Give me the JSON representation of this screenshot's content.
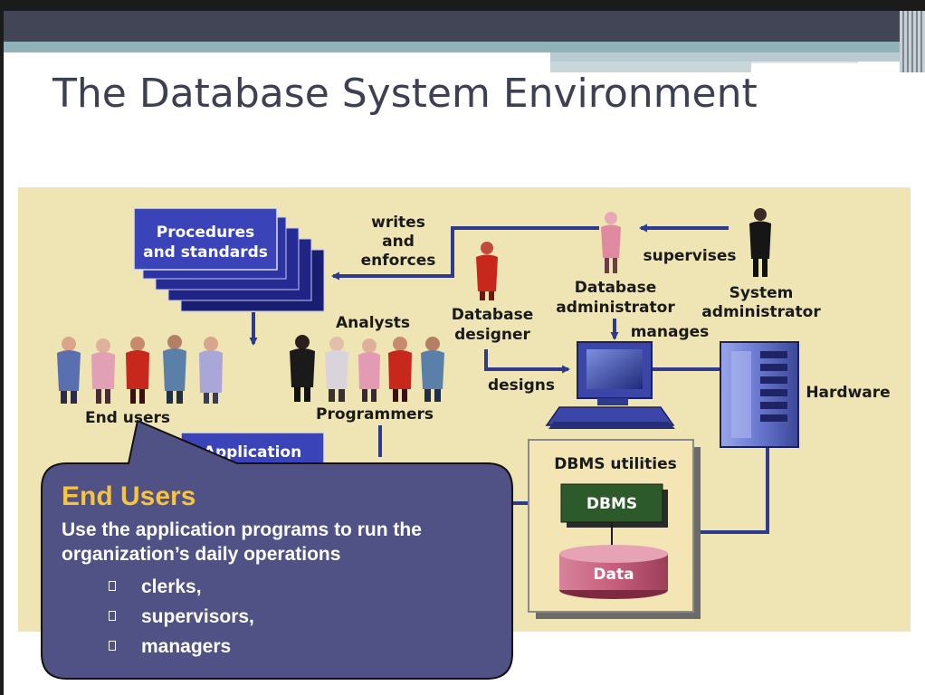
{
  "slide": {
    "title": "The Database System Environment"
  },
  "diagram": {
    "procedures_label": [
      "Procedures",
      "and standards"
    ],
    "writes_enforces_label": [
      "writes",
      "and",
      "enforces"
    ],
    "supervises_label": "supervises",
    "dba_label": [
      "Database",
      "administrator"
    ],
    "sysadmin_label": [
      "System",
      "administrator"
    ],
    "designer_label": [
      "Database",
      "designer"
    ],
    "analysts_label": "Analysts",
    "manages_label": "manages",
    "end_users_label": "End users",
    "programmers_label": "Programmers",
    "designs_label": "designs",
    "hardware_label": "Hardware",
    "application_label": "Application",
    "dbms_utilities_label": "DBMS utilities",
    "dbms_label": "DBMS",
    "data_label": "Data"
  },
  "callout": {
    "title": "End Users",
    "text": [
      "Use the application programs to run the",
      "organization’s daily operations"
    ],
    "items": [
      "clerks,",
      "supervisors,",
      "managers"
    ]
  },
  "colors": {
    "title": "#3d3f52",
    "panel": "#efe4b3",
    "arrow": "#2e3a8c",
    "callout_fill": "#505184",
    "callout_title": "#f6c343"
  }
}
